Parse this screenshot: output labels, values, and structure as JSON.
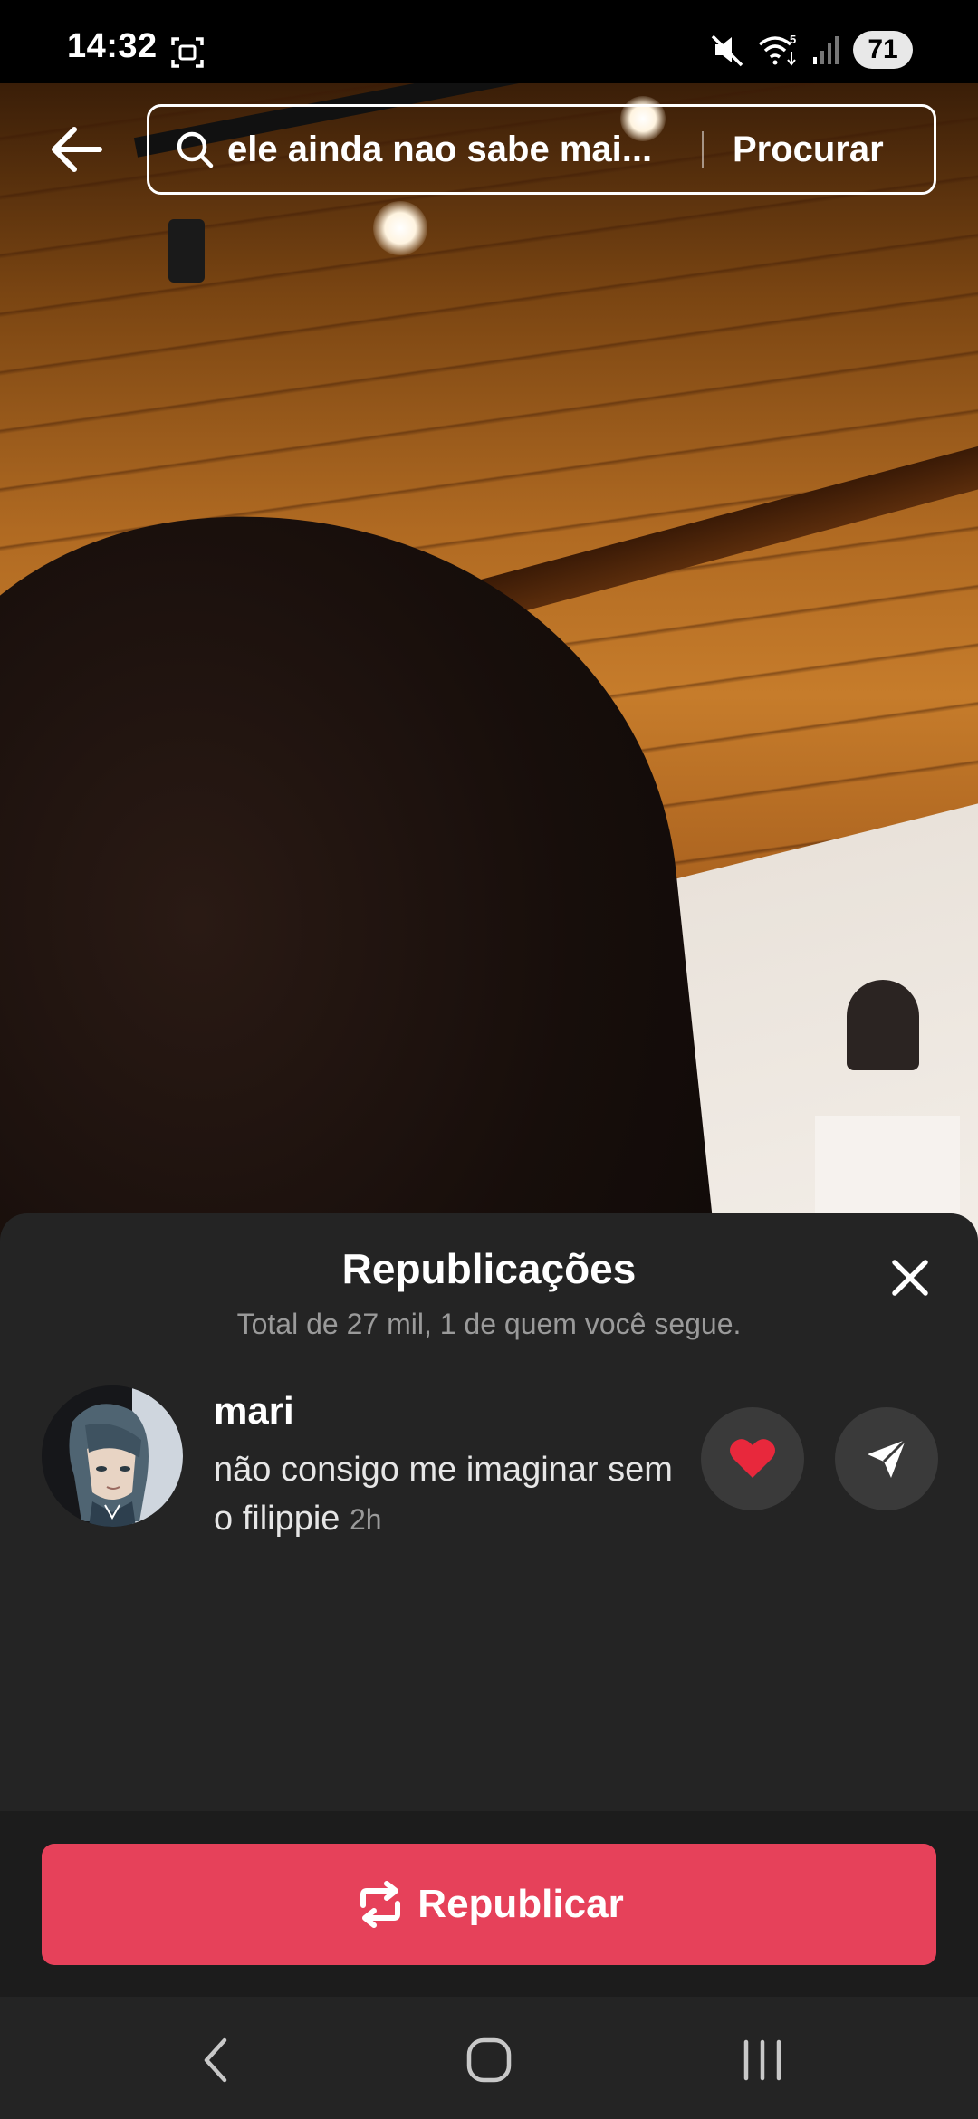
{
  "status_bar": {
    "time": "14:32",
    "battery": "71",
    "icons": [
      "screenshot-icon",
      "mute-icon",
      "wifi-icon",
      "signal-icon",
      "battery-icon"
    ]
  },
  "search": {
    "query": "ele ainda nao sabe mai...",
    "button_label": "Procurar"
  },
  "sheet": {
    "title": "Republicações",
    "subtitle": "Total de 27 mil, 1 de quem você segue.",
    "reposts": [
      {
        "username": "mari",
        "caption": "não consigo me imaginar sem o filippie",
        "time": "2h"
      }
    ]
  },
  "footer": {
    "repost_label": "Republicar"
  },
  "colors": {
    "accent": "#e6415a",
    "sheet_bg": "#242424",
    "muted_text": "#9a9a9a",
    "heart": "#e8283c"
  }
}
